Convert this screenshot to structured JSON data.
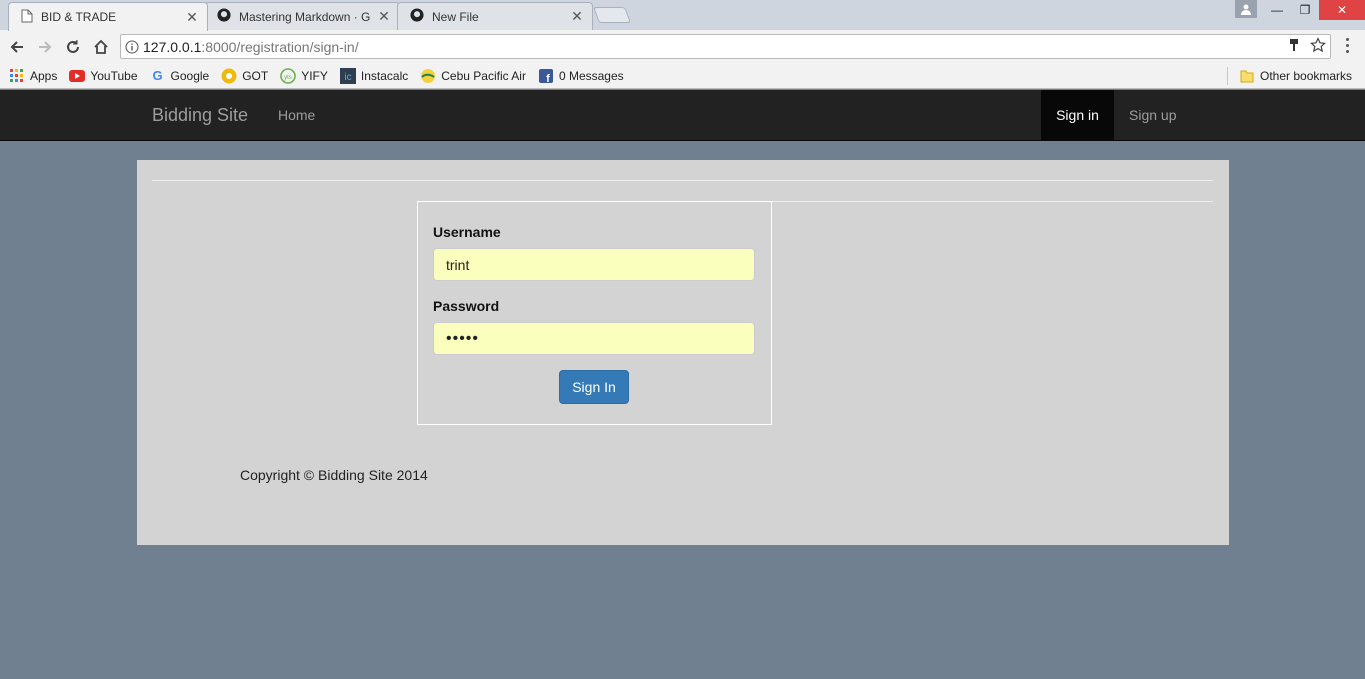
{
  "browser": {
    "tabs": [
      {
        "title": "BID & TRADE",
        "active": true
      },
      {
        "title": "Mastering Markdown · G",
        "active": false
      },
      {
        "title": "New File",
        "active": false
      }
    ],
    "url_host": "127.0.0.1",
    "url_rest": ":8000/registration/sign-in/",
    "bookmarks": [
      {
        "label": "Apps",
        "icon": "apps-grid-icon"
      },
      {
        "label": "YouTube",
        "icon": "youtube-icon"
      },
      {
        "label": "Google",
        "icon": "google-icon"
      },
      {
        "label": "GOT",
        "icon": "got-icon"
      },
      {
        "label": "YIFY",
        "icon": "yify-icon"
      },
      {
        "label": "Instacalc",
        "icon": "instacalc-icon"
      },
      {
        "label": "Cebu Pacific Air",
        "icon": "cebu-pacific-icon"
      },
      {
        "label": "0 Messages",
        "icon": "facebook-icon"
      }
    ],
    "other_bookmarks": "Other bookmarks"
  },
  "navbar": {
    "brand": "Bidding Site",
    "home": "Home",
    "sign_in": "Sign in",
    "sign_up": "Sign up"
  },
  "form": {
    "username_label": "Username",
    "username_value": "trint",
    "password_label": "Password",
    "password_value": "•••••",
    "submit_label": "Sign In"
  },
  "footer": {
    "copyright": "Copyright © Bidding Site 2014"
  },
  "colors": {
    "page_bg": "#708090",
    "navbar_bg": "#222222",
    "panel_bg": "#d3d3d3",
    "autofill_bg": "#faffbd",
    "primary_button": "#337ab7"
  }
}
